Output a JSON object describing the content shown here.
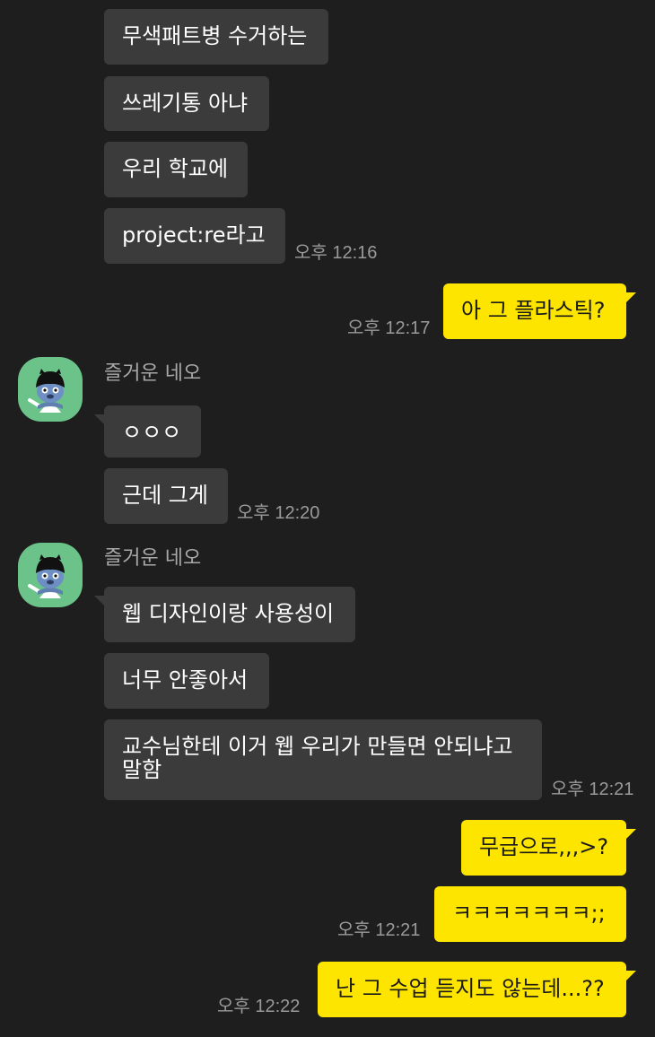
{
  "colors": {
    "background": "#1e1e1e",
    "incoming_bubble": "#3b3b3b",
    "outgoing_bubble": "#fee500",
    "timestamp_text": "#9a9a9a",
    "sender_name_text": "#a8a8a8",
    "avatar_background": "#6bc389"
  },
  "icons": {
    "avatar": "character-avatar-icon"
  },
  "messages": [
    {
      "direction": "in",
      "text": "무색패트병 수거하는"
    },
    {
      "direction": "in",
      "text": "쓰레기통 아냐"
    },
    {
      "direction": "in",
      "text": "우리 학교에"
    },
    {
      "direction": "in",
      "text": "project:re라고",
      "time": "오후 12:16"
    },
    {
      "direction": "out",
      "text": "아 그 플라스틱?",
      "time": "오후 12:17"
    },
    {
      "direction": "in",
      "sender": "즐거운 네오",
      "text": "ㅇㅇㅇ"
    },
    {
      "direction": "in",
      "text": "근데 그게",
      "time": "오후 12:20"
    },
    {
      "direction": "in",
      "sender": "즐거운 네오",
      "text": "웹 디자인이랑 사용성이"
    },
    {
      "direction": "in",
      "text": "너무 안좋아서"
    },
    {
      "direction": "in",
      "text": "교수님한테 이거 웹 우리가 만들면 안되냐고 말함",
      "time": "오후 12:21"
    },
    {
      "direction": "out",
      "text": "무급으로,,,>?"
    },
    {
      "direction": "out",
      "text": "ㅋㅋㅋㅋㅋㅋㅋ;;",
      "time": "오후 12:21"
    },
    {
      "direction": "out",
      "text": "난 그 수업 듣지도 않는데...??",
      "time": "오후 12:22"
    }
  ]
}
